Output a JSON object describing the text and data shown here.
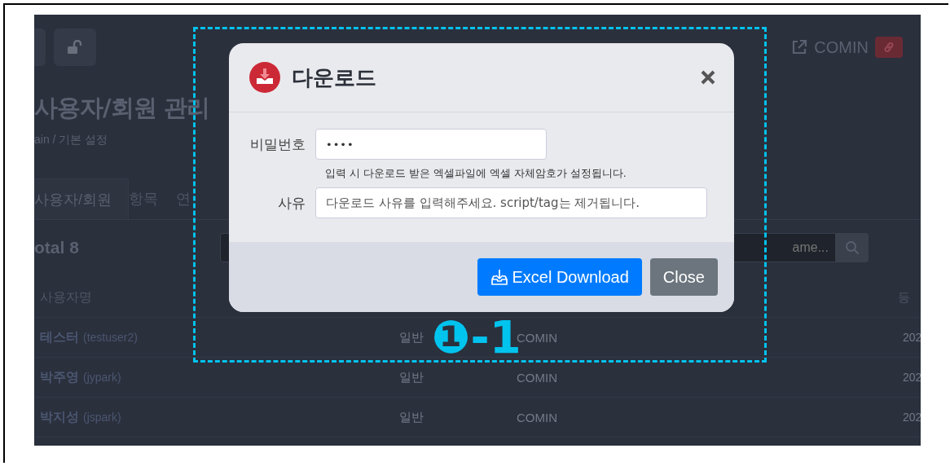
{
  "topbar": {
    "user": "COMIN"
  },
  "page": {
    "title": "사용자/회원 관리",
    "breadcrumb": "ain  /  기본 설정"
  },
  "tabs": [
    {
      "label": "사용자/회원",
      "selected": true
    },
    {
      "label": "항목",
      "selected": false
    },
    {
      "label": "연",
      "selected": false
    }
  ],
  "total": "otal 8",
  "search": {
    "placeholder": "ame..."
  },
  "table": {
    "columns": {
      "name": "사용자명",
      "date": "등"
    },
    "rows": [
      {
        "name": "테스터",
        "id": "(testuser2)",
        "type": "일반",
        "company": "COMIN",
        "date": "202"
      },
      {
        "name": "박주영",
        "id": "(jypark)",
        "type": "일반",
        "company": "COMIN",
        "date": "202"
      },
      {
        "name": "박지성",
        "id": "(jspark)",
        "type": "일반",
        "company": "COMIN",
        "date": "202"
      }
    ]
  },
  "modal": {
    "title": "다운로드",
    "fields": [
      {
        "kind": "password",
        "label": "비밀번호",
        "value": "••••",
        "help": "입력 시 다운로드 받은 엑셀파일에 엑셀 자체암호가 설정됩니다."
      },
      {
        "kind": "text",
        "label": "사유",
        "placeholder": "다운로드 사유를 입력해주세요. script/tag는 제거됩니다."
      }
    ],
    "buttons": [
      {
        "label": "Excel Download",
        "kind": "primary"
      },
      {
        "label": "Close",
        "kind": "secondary"
      }
    ]
  },
  "annotation": {
    "label": "❶-1"
  }
}
